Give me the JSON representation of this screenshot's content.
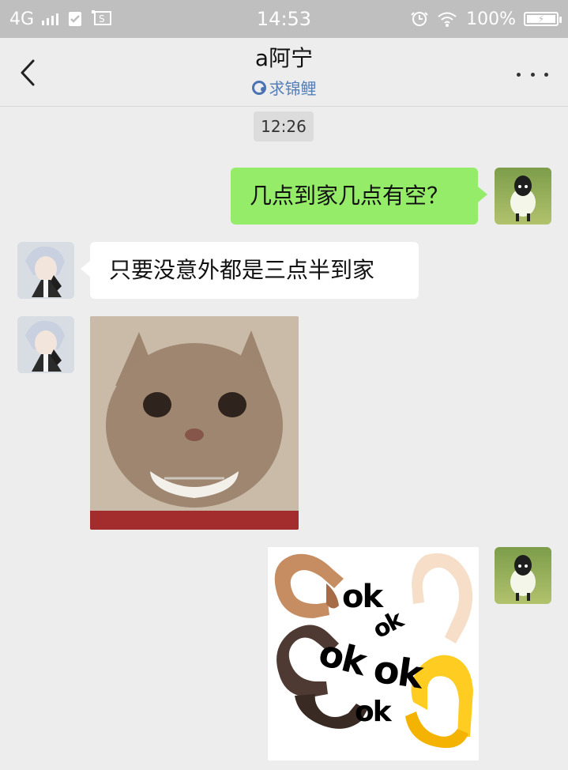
{
  "status_bar": {
    "network": "4G",
    "time": "14:53",
    "battery": "100%"
  },
  "header": {
    "title": "a阿宁",
    "subtitle": "求锦鲤"
  },
  "chat": {
    "timestamp": "12:26",
    "messages": [
      {
        "text": "几点到家几点有空？"
      },
      {
        "text": "只要没意外都是三点半到家"
      }
    ]
  },
  "ok_sticker": {
    "words": [
      "ok",
      "ok",
      "ok",
      "ok",
      "ok"
    ]
  }
}
